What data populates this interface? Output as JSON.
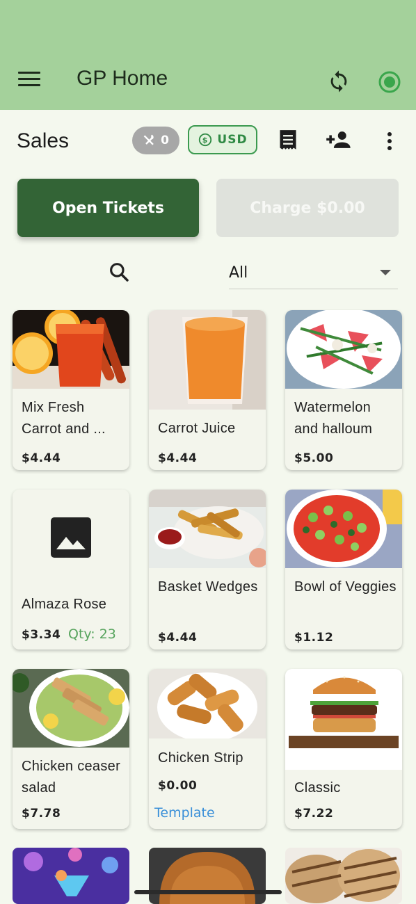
{
  "app": {
    "title": "GP Home"
  },
  "toolbar": {
    "title": "Sales",
    "dine_count": "0",
    "currency": "USD"
  },
  "actions": {
    "open_tickets": "Open Tickets",
    "charge": "Charge $0.00"
  },
  "filter": {
    "category": "All"
  },
  "items": [
    {
      "name": "Mix Fresh Carrot and ...",
      "price": "$4.44"
    },
    {
      "name": "Carrot Juice",
      "price": "$4.44"
    },
    {
      "name": "Watermelon and halloum",
      "price": "$5.00"
    },
    {
      "name": "Almaza Rose",
      "price": "$3.34",
      "qty": "Qty: 23"
    },
    {
      "name": "Basket Wedges",
      "price": "$4.44"
    },
    {
      "name": "Bowl of Veggies",
      "price": "$1.12"
    },
    {
      "name": "Chicken ceaser salad",
      "price": "$7.78"
    },
    {
      "name": "Chicken Strip",
      "price": "$0.00",
      "tag": "Template"
    },
    {
      "name": "Classic",
      "price": "$7.22"
    }
  ],
  "icons": [
    "menu-icon",
    "sync-icon",
    "status-icon",
    "utensils-icon",
    "currency-exchange-icon",
    "receipt-icon",
    "add-person-icon",
    "more-vertical-icon",
    "search-icon",
    "dropdown-icon",
    "image-placeholder-icon"
  ],
  "colors": {
    "appbar": "#a4d19b",
    "primary": "#336436",
    "accent": "#3b9a4f",
    "qty": "#56a35c",
    "template": "#3a8fd8"
  }
}
